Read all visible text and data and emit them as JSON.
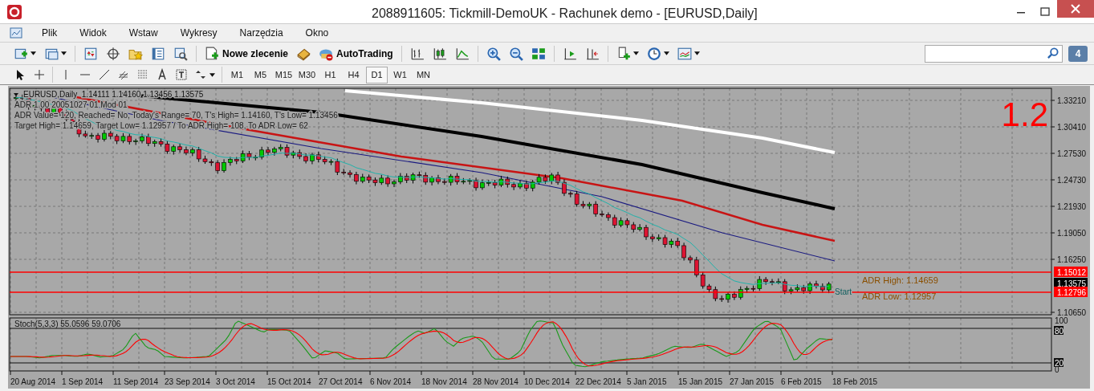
{
  "window": {
    "title": "2088911605: Tickmill-DemoUK - Rachunek demo - [EURUSD,Daily]"
  },
  "menu": [
    "Plik",
    "Widok",
    "Wstaw",
    "Wykresy",
    "Narzędzia",
    "Okno"
  ],
  "toolbar": {
    "new_order": "Nowe zlecenie",
    "autotrading": "AutoTrading",
    "notifications": "4"
  },
  "timeframes": [
    {
      "label": "M1",
      "selected": false
    },
    {
      "label": "M5",
      "selected": false
    },
    {
      "label": "M15",
      "selected": false
    },
    {
      "label": "M30",
      "selected": false
    },
    {
      "label": "H1",
      "selected": false
    },
    {
      "label": "H4",
      "selected": false
    },
    {
      "label": "D1",
      "selected": true
    },
    {
      "label": "W1",
      "selected": false
    },
    {
      "label": "MN",
      "selected": false
    }
  ],
  "chart": {
    "header": "EURUSD,Daily  1.14111 1.14160 1.13456 1.13575",
    "indicator_lines": [
      "ADR 1.00 20051027 01 Mod 01",
      "ADR Value= 120, Reached= No, Today's Range= 70, T's High= 1.14160, T's Low= 1.13456",
      "Target High= 1.14659, Target Low= 1.12957 / To ADR High= 108, To ADR Low= 62"
    ],
    "big_label": "1.2",
    "price_ticks": [
      "1.33210",
      "1.30410",
      "1.27530",
      "1.24730",
      "1.21930",
      "1.19050",
      "1.16250",
      "1.10650"
    ],
    "price_tags": [
      {
        "text": "1.15012",
        "color": "#ff0000"
      },
      {
        "text": "1.13575",
        "color": "#000000"
      },
      {
        "text": "1.12796",
        "color": "#ff0000"
      }
    ],
    "adr_labels": [
      "ADR High: 1.14659",
      "ADR Low: 1.12957"
    ],
    "start_label": "Start",
    "stoch": {
      "label": "Stoch(5,3,3) 55.0596 59.0706",
      "levels": [
        "100",
        "80",
        "20",
        "0"
      ]
    },
    "dates": [
      "20 Aug 2014",
      "1 Sep 2014",
      "11 Sep 2014",
      "23 Sep 2014",
      "3 Oct 2014",
      "15 Oct 2014",
      "27 Oct 2014",
      "6 Nov 2014",
      "18 Nov 2014",
      "28 Nov 2014",
      "10 Dec 2014",
      "22 Dec 2014",
      "5 Jan 2015",
      "15 Jan 2015",
      "27 Jan 2015",
      "6 Feb 2015",
      "18 Feb 2015"
    ]
  }
}
